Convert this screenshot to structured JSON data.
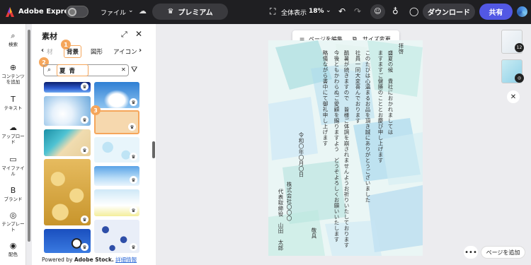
{
  "topbar": {
    "brand": "Adobe Express",
    "file_label": "ファイル",
    "chevron": "⌄",
    "cloud_icon": "☁",
    "premium_label": "プレミアム",
    "fullscreen_label": "全体表示",
    "zoom": "18%",
    "undo": "↶",
    "redo": "↷",
    "download_label": "ダウンロード",
    "share_label": "共有",
    "colors": {
      "bg": "#1f1f22",
      "share": "#5258e4"
    }
  },
  "leftnav": [
    {
      "icon": "⌕",
      "label": "検索"
    },
    {
      "icon": "⊕",
      "label": "コンテンツ\nを追加"
    },
    {
      "icon": "T",
      "label": "テキスト"
    },
    {
      "icon": "☁",
      "label": "アップロー\nド"
    },
    {
      "icon": "▭",
      "label": "マイファイ\nル"
    },
    {
      "icon": "B",
      "label": "ブランド"
    },
    {
      "icon": "◎",
      "label": "テンプレー\nト"
    },
    {
      "icon": "◉",
      "label": "配色"
    }
  ],
  "panel": {
    "title": "素材",
    "expand_icon": "⤢",
    "close_icon": "✕",
    "tabs": [
      "材",
      "背景",
      "図形",
      "アイコン"
    ],
    "selected_tab": "背景",
    "search_value": "夏 青",
    "clear_icon": "✕",
    "filter_icon": "⛛",
    "callouts": [
      "1",
      "2",
      "3"
    ],
    "credit_prefix": "Powered by",
    "credit_brand": "Adobe Stock.",
    "credit_link": "詳細情報"
  },
  "canvas": {
    "edit_page_label": "ページを編集",
    "resize_label": "サイズ変更",
    "letter_columns": [
      "拝啓",
      "盛夏の候　貴社におかれましては",
      "ますますご健勝のこととお慶び申し上げます",
      "このたびは心温まるお品を頂き誠にありがとうございました",
      "社員一同大変喜んでおります",
      "酷暑が続きますので　皆様ご体調を崩されませんようお祈りいたしております",
      "今後ともかわらぬご愛顧を賜りますよう　どうぞよろしくお願いいたします",
      "略儀ながら書中にて御礼申し上げます",
      "令和〇年〇月〇日",
      "株式会社〇〇〇",
      "代表取締役　山田　太郎",
      "敬具"
    ]
  },
  "right": {
    "page1_badge": "12",
    "close_icon": "✕",
    "more_icon": "•••",
    "add_page_label": "ページを追加"
  }
}
